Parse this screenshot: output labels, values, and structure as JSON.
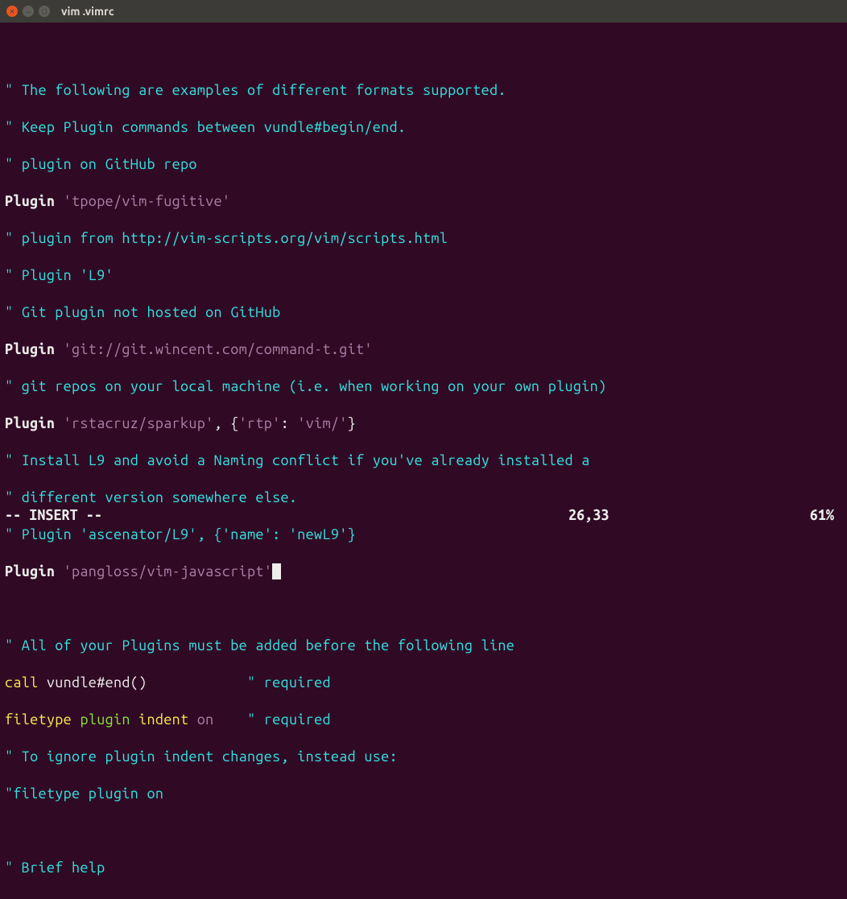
{
  "titlebar": {
    "title": "vim .vimrc"
  },
  "lines": {
    "c1": "\" The following are examples of different formats supported.",
    "c2": "\" Keep Plugin commands between vundle#begin/end.",
    "c3": "\" plugin on GitHub repo",
    "p1_kw": "Plugin",
    "p1_str": "'tpope/vim-fugitive'",
    "c4": "\" plugin from http://vim-scripts.org/vim/scripts.html",
    "c5": "\" Plugin 'L9'",
    "c6": "\" Git plugin not hosted on GitHub",
    "p2_kw": "Plugin",
    "p2_str": "'git://git.wincent.com/command-t.git'",
    "c7": "\" git repos on your local machine (i.e. when working on your own plugin)",
    "p3_kw": "Plugin",
    "p3_str": "'rstacruz/sparkup'",
    "p3_rest": ", {",
    "p3_rtp": "'rtp'",
    "p3_colon": ": ",
    "p3_val": "'vim/'",
    "p3_close": "}",
    "c8": "\" Install L9 and avoid a Naming conflict if you've already installed a",
    "c9": "\" different version somewhere else.",
    "c10": "\" Plugin 'ascenator/L9', {'name': 'newL9'}",
    "p4_kw": "Plugin",
    "p4_str": "'pangloss/vim-javascript'",
    "c11": "\" All of your Plugins must be added before the following line",
    "call_kw": "call",
    "call_fn": " vundle#end()            ",
    "call_cmt": "\" required",
    "ft_kw": "filetype",
    "ft_plugin": "plugin",
    "ft_indent": "indent",
    "ft_on": "on",
    "ft_cmt": "\" required",
    "c12": "\" To ignore plugin indent changes, instead use:",
    "c13": "\"filetype plugin on",
    "c14": "\" Brief help"
  },
  "status": {
    "mode": "-- INSERT --",
    "pos": "26,33",
    "pct": "61%"
  }
}
